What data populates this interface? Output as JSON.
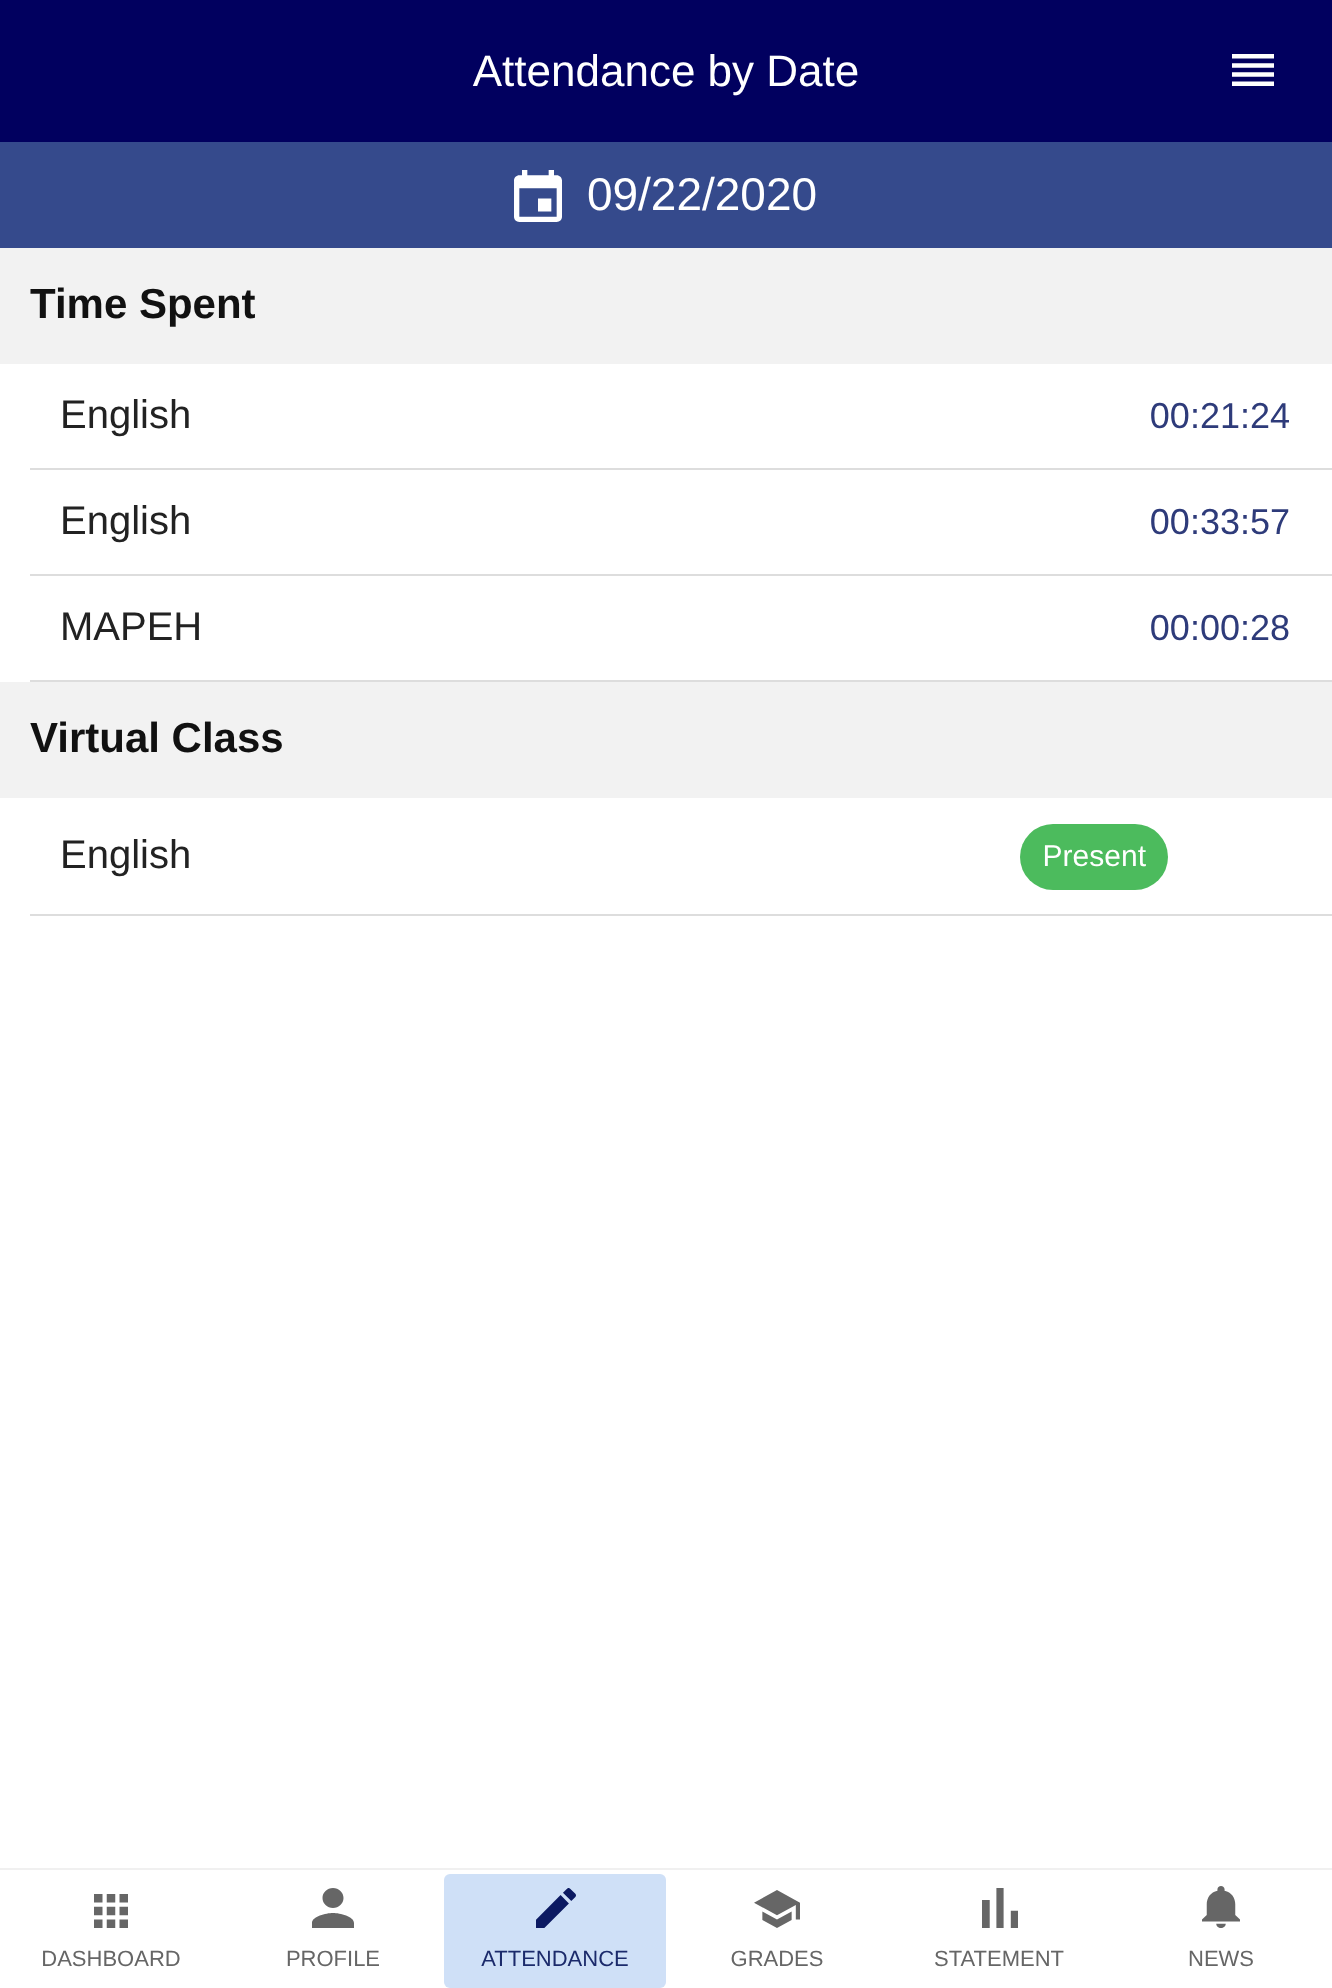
{
  "app_bar": {
    "title": "Attendance by Date"
  },
  "date_bar": {
    "date": "09/22/2020"
  },
  "sections": [
    {
      "title": "Time Spent",
      "rows": [
        {
          "kind": "duration",
          "subject": "English",
          "value": "00:21:24"
        },
        {
          "kind": "duration",
          "subject": "English",
          "value": "00:33:57"
        },
        {
          "kind": "duration",
          "subject": "MAPEH",
          "value": "00:00:28"
        }
      ]
    },
    {
      "title": "Virtual Class",
      "rows": [
        {
          "kind": "status",
          "subject": "English",
          "value": "Present"
        }
      ]
    }
  ],
  "bottom_nav": [
    {
      "label": "DASHBOARD",
      "selected": false
    },
    {
      "label": "PROFILE",
      "selected": false
    },
    {
      "label": "ATTENDANCE",
      "selected": true
    },
    {
      "label": "GRADES",
      "selected": false
    },
    {
      "label": "STATEMENT",
      "selected": false
    },
    {
      "label": "NEWS",
      "selected": false
    }
  ]
}
